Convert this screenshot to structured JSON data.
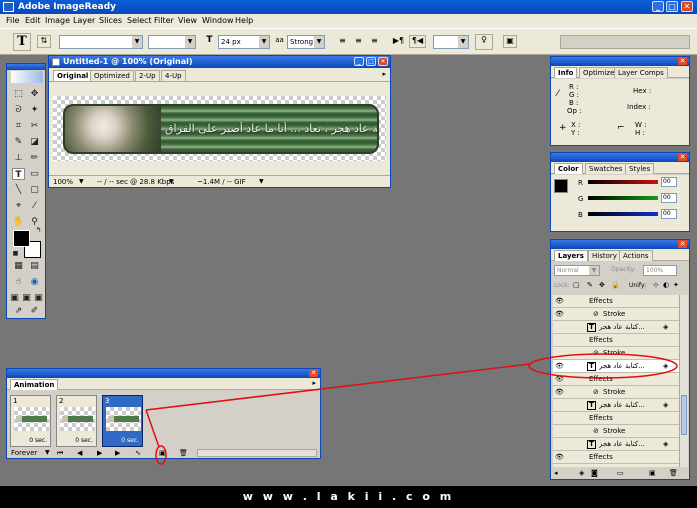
{
  "app": {
    "title": "Adobe ImageReady"
  },
  "menu": [
    "File",
    "Edit",
    "Image",
    "Layer",
    "Slices",
    "Select",
    "Filter",
    "View",
    "Window",
    "Help"
  ],
  "options_bar": {
    "font_size": "24 px",
    "antialias": "Strong",
    "aa_label": "aa"
  },
  "document": {
    "title": "Untitled-1 @ 100% (Original)",
    "tabs": [
      "Original",
      "Optimized",
      "2-Up",
      "4-Up"
    ],
    "status": {
      "zoom": "100%",
      "download": "-- / -- sec @ 28.8 Kbps",
      "size": "~1.4M / -- GIF"
    },
    "banner_text": "كتابة عاد هجر ، تعاد ... أنا ما عاد أصبر على الفراق"
  },
  "info_panel": {
    "tabs": [
      "Info",
      "Optimize",
      "Layer Comps"
    ],
    "labels": {
      "r": "R :",
      "g": "G :",
      "b": "B :",
      "op": "Op :",
      "hex": "Hex :",
      "index": "Index :",
      "x": "X :",
      "y": "Y :",
      "w": "W :",
      "h": "H :"
    }
  },
  "color_panel": {
    "tabs": [
      "Color",
      "Swatches",
      "Styles"
    ],
    "channels": [
      {
        "label": "R",
        "value": "00",
        "color": "#d01010"
      },
      {
        "label": "G",
        "value": "00",
        "color": "#10a010"
      },
      {
        "label": "B",
        "value": "00",
        "color": "#1030d0"
      }
    ]
  },
  "layers_panel": {
    "tabs": [
      "Layers",
      "History",
      "Actions"
    ],
    "blend_mode": "Normal",
    "opacity_label": "Opacity:",
    "opacity": "100%",
    "lock_label": "Lock:",
    "unify_label": "Unify:",
    "rows": [
      {
        "kind": "effects",
        "label": "Effects"
      },
      {
        "kind": "effect",
        "label": "Stroke"
      },
      {
        "kind": "layer",
        "label": "كتابة عاد هجر..."
      },
      {
        "kind": "effects",
        "label": "Effects"
      },
      {
        "kind": "effect",
        "label": "Stroke"
      },
      {
        "kind": "layer",
        "label": "كتابة عاد هجر..."
      },
      {
        "kind": "effects",
        "label": "Effects"
      },
      {
        "kind": "effect",
        "label": "Stroke"
      },
      {
        "kind": "layer",
        "label": "كتابة عاد هجر..."
      },
      {
        "kind": "effects",
        "label": "Effects"
      },
      {
        "kind": "effect",
        "label": "Stroke"
      },
      {
        "kind": "layer",
        "label": "كتابة عاد هجر..."
      },
      {
        "kind": "effects",
        "label": "Effects"
      }
    ]
  },
  "animation_panel": {
    "tab": "Animation",
    "frames": [
      {
        "num": "1",
        "delay": "0 sec."
      },
      {
        "num": "2",
        "delay": "0 sec."
      },
      {
        "num": "3",
        "delay": "0 sec."
      }
    ],
    "loop": "Forever"
  },
  "footer": {
    "text": "w w w . l a k i i . c o m"
  }
}
